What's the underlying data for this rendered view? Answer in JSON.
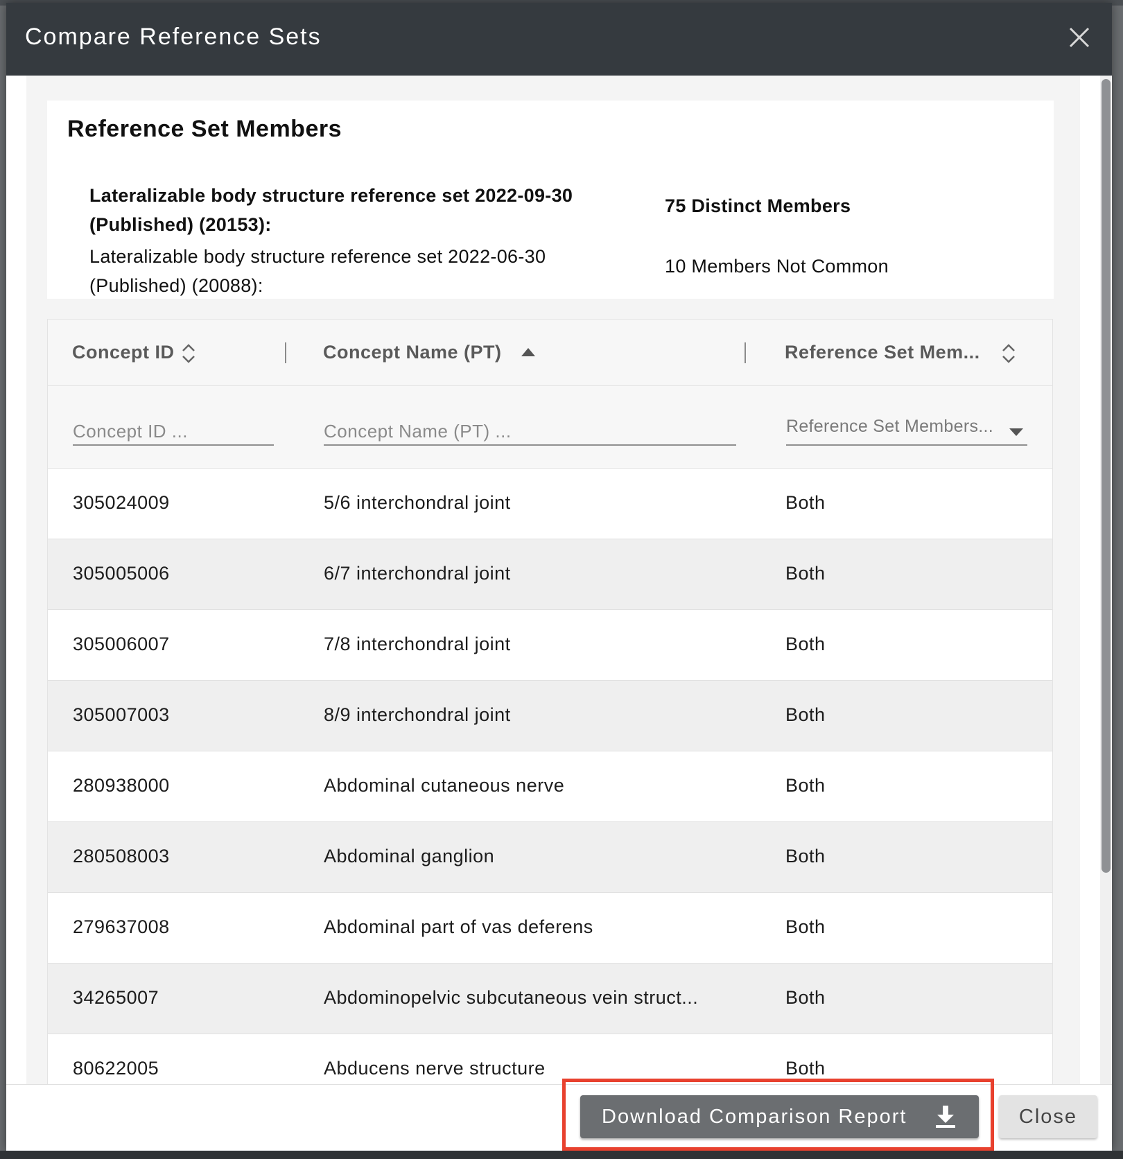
{
  "modal": {
    "title": "Compare Reference Sets",
    "close_icon": "close-icon"
  },
  "summary": {
    "title": "Reference Set Members",
    "set_a_line1": "Lateralizable body structure reference set 2022-09-30",
    "set_a_line2": "(Published) (20153):",
    "set_b_line1": "Lateralizable body structure reference set 2022-06-30",
    "set_b_line2": "(Published) (20088):",
    "distinct_members": "75 Distinct Members",
    "members_not_common": "10 Members Not Common"
  },
  "table": {
    "columns": [
      {
        "label": "Concept ID",
        "sort": "unsorted",
        "sort_icon": "sort-both-icon"
      },
      {
        "label": "Concept Name (PT)",
        "sort": "ascending",
        "sort_icon": "sort-asc-icon"
      },
      {
        "label": "Reference Set Mem...",
        "sort": "unsorted",
        "sort_icon": "sort-both-icon"
      }
    ],
    "filters": {
      "concept_id_placeholder": "Concept ID ...",
      "concept_name_placeholder": "Concept Name (PT) ...",
      "members_select_placeholder": "Reference Set Members..."
    },
    "rows": [
      {
        "id": "305024009",
        "name": "5/6 interchondral joint",
        "member": "Both"
      },
      {
        "id": "305005006",
        "name": "6/7 interchondral joint",
        "member": "Both"
      },
      {
        "id": "305006007",
        "name": "7/8 interchondral joint",
        "member": "Both"
      },
      {
        "id": "305007003",
        "name": "8/9 interchondral joint",
        "member": "Both"
      },
      {
        "id": "280938000",
        "name": "Abdominal cutaneous nerve",
        "member": "Both"
      },
      {
        "id": "280508003",
        "name": "Abdominal ganglion",
        "member": "Both"
      },
      {
        "id": "279637008",
        "name": "Abdominal part of vas deferens",
        "member": "Both"
      },
      {
        "id": "34265007",
        "name": "Abdominopelvic subcutaneous vein struct...",
        "member": "Both"
      },
      {
        "id": "80622005",
        "name": "Abducens nerve structure",
        "member": "Both"
      }
    ]
  },
  "footer": {
    "download_label": "Download Comparison Report",
    "download_icon": "download-icon",
    "close_label": "Close"
  },
  "colors": {
    "header_bg": "#353a3f",
    "highlight": "#e8412e",
    "primary_button": "#6b6e71"
  }
}
